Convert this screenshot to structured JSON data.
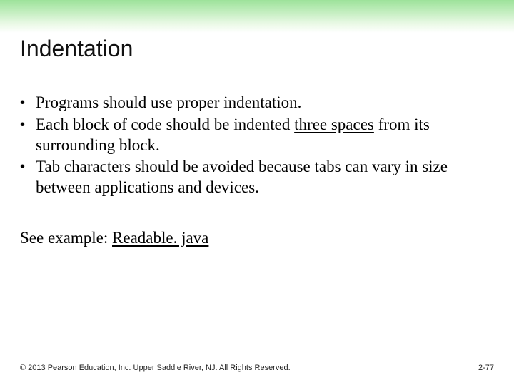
{
  "title": "Indentation",
  "bullets": [
    {
      "pre": "Programs should use proper indentation.",
      "u": "",
      "post": ""
    },
    {
      "pre": "Each block of code should be indented ",
      "u": "three spaces",
      "post": " from its surrounding block."
    },
    {
      "pre": "Tab characters should be avoided because tabs can vary in size between applications and devices.",
      "u": "",
      "post": ""
    }
  ],
  "example": {
    "label": "See example: ",
    "link": "Readable. java"
  },
  "footer": {
    "copyright": "© 2013 Pearson Education, Inc. Upper Saddle River, NJ. All Rights Reserved.",
    "pageno": "2-77"
  }
}
